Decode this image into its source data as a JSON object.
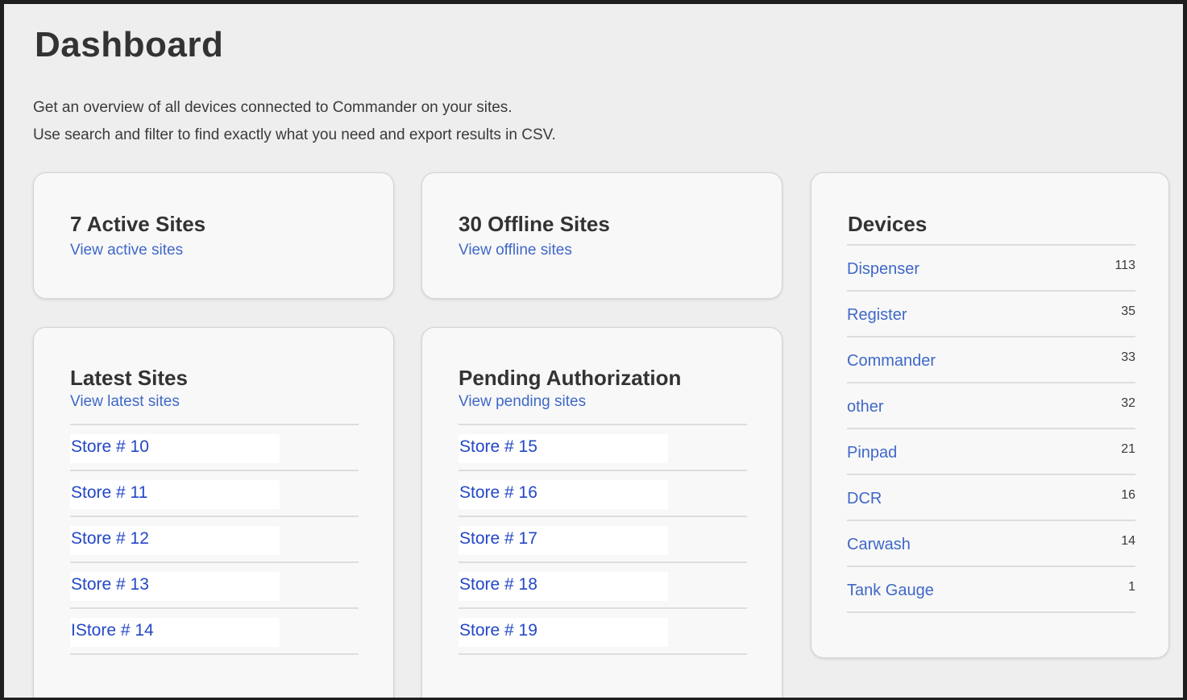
{
  "page": {
    "title": "Dashboard",
    "intro_line1": "Get an overview of all devices connected to Commander on your sites.",
    "intro_line2": "Use search and filter to find exactly what you need and export results in CSV."
  },
  "active_sites": {
    "title": "7 Active Sites",
    "link": "View active sites"
  },
  "offline_sites": {
    "title": "30 Offline Sites",
    "link": "View offline sites"
  },
  "latest_sites": {
    "title": "Latest Sites",
    "link": "View latest sites",
    "items": [
      "Store # 10",
      "Store # 11",
      "Store # 12",
      "Store # 13",
      "IStore # 14"
    ]
  },
  "pending_authorization": {
    "title": "Pending Authorization",
    "link": "View pending sites",
    "items": [
      "Store # 15",
      "Store # 16",
      "Store # 17",
      "Store # 18",
      "Store # 19"
    ]
  },
  "devices": {
    "title": "Devices",
    "items": [
      {
        "name": "Dispenser",
        "count": "113"
      },
      {
        "name": "Register",
        "count": "35"
      },
      {
        "name": "Commander",
        "count": "33"
      },
      {
        "name": "other",
        "count": "32"
      },
      {
        "name": "Pinpad",
        "count": "21"
      },
      {
        "name": "DCR",
        "count": "16"
      },
      {
        "name": "Carwash",
        "count": "14"
      },
      {
        "name": "Tank Gauge",
        "count": "1"
      }
    ]
  },
  "colors": {
    "link": "#3f68c8",
    "store_link": "#2347c6",
    "background": "#eeeeee",
    "card": "#f8f8f8"
  }
}
